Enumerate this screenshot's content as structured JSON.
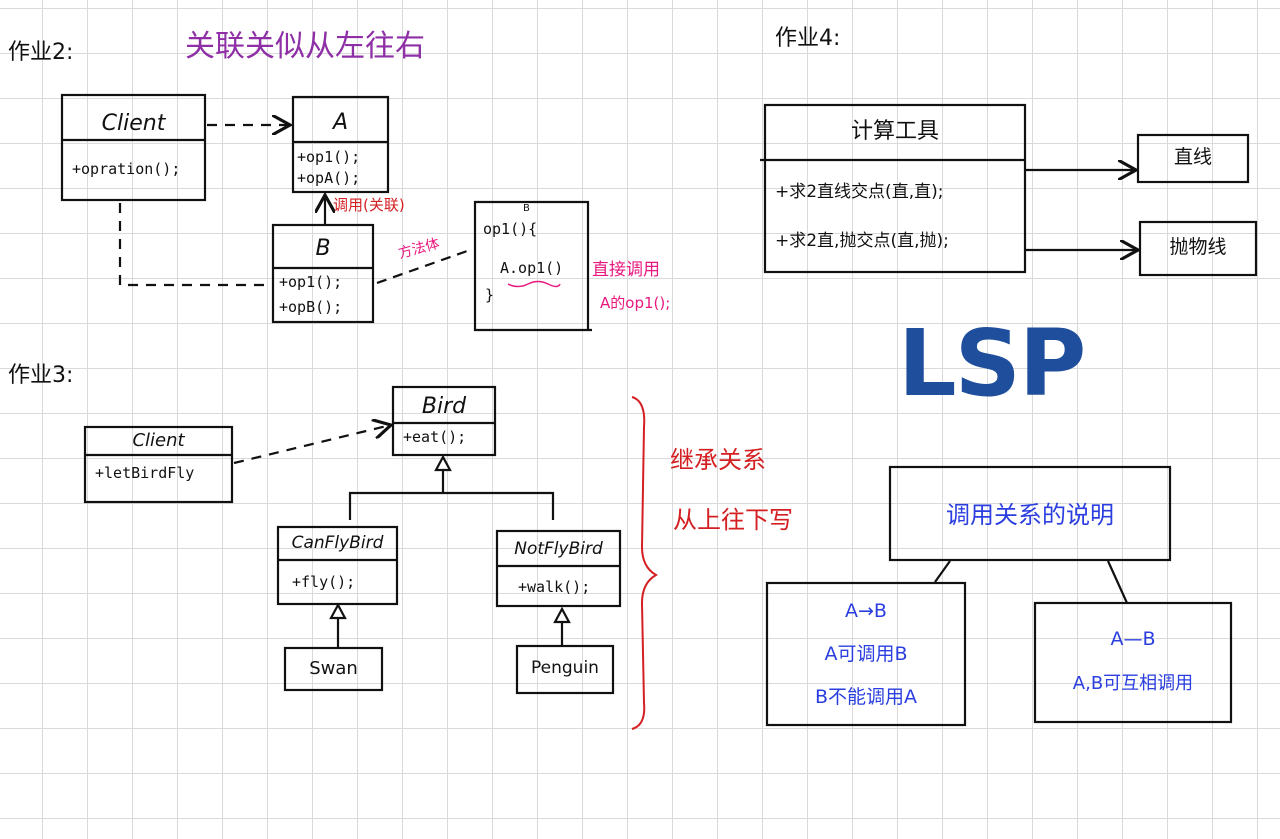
{
  "colors": {
    "purple": "#8e2fa6",
    "red": "#d41f22",
    "pink": "#e8187f",
    "blue": "#2b3fe0",
    "lsp": "#1f4f9c"
  },
  "hw2": {
    "heading": "作业2:",
    "note": "关联关似从左往右",
    "client": {
      "name": "Client",
      "methods": [
        "+opration();"
      ]
    },
    "a": {
      "name": "A",
      "methods": [
        "+op1();",
        "+opA();"
      ]
    },
    "b": {
      "name": "B",
      "methods": [
        "+op1();",
        "+opB();"
      ]
    },
    "call_label": "调用(关联)",
    "method_body_label": "方法体",
    "method_body": {
      "title": "B",
      "open": "op1(){",
      "call": "A.op1()",
      "close": "}"
    },
    "direct_call": [
      "直接调用",
      "A的op1();"
    ]
  },
  "hw3": {
    "heading": "作业3:",
    "client": {
      "name": "Client",
      "methods": [
        "+letBirdFly"
      ]
    },
    "bird": {
      "name": "Bird",
      "methods": [
        "+eat();"
      ]
    },
    "canfly": {
      "name": "CanFlyBird",
      "methods": [
        "+fly();"
      ]
    },
    "notfly": {
      "name": "NotFlyBird",
      "methods": [
        "+walk();"
      ]
    },
    "swan": "Swan",
    "penguin": "Penguin",
    "note": [
      "继承关系",
      "从上往下写"
    ]
  },
  "hw4": {
    "heading": "作业4:",
    "tool": {
      "name": "计算工具",
      "methods": [
        "+求2直线交点(直,直);",
        "+求2直,抛交点(直,抛);"
      ]
    },
    "line": "直线",
    "parabola": "抛物线"
  },
  "lsp": {
    "title": "LSP",
    "root": "调用关系的说明",
    "left": [
      "A→B",
      "A可调用B",
      "B不能调用A"
    ],
    "right": [
      "A—B",
      "A,B可互相调用"
    ]
  }
}
